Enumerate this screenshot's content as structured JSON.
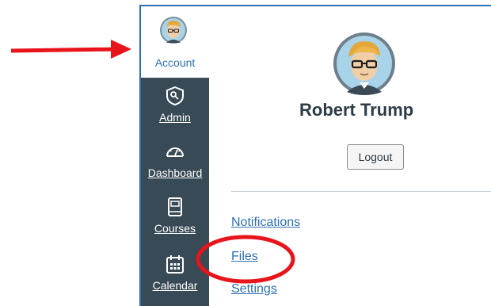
{
  "account": {
    "label": "Account"
  },
  "nav": [
    {
      "label": "Admin",
      "icon": "admin-shield-icon"
    },
    {
      "label": "Dashboard",
      "icon": "dashboard-gauge-icon"
    },
    {
      "label": "Courses",
      "icon": "courses-book-icon"
    },
    {
      "label": "Calendar",
      "icon": "calendar-icon"
    }
  ],
  "profile": {
    "name": "Robert Trump",
    "logout_label": "Logout"
  },
  "links": {
    "notifications": "Notifications",
    "files": "Files",
    "settings": "Settings"
  },
  "colors": {
    "nav_bg": "#384a55",
    "link": "#2d6fb0",
    "annotation": "#e8141c"
  }
}
